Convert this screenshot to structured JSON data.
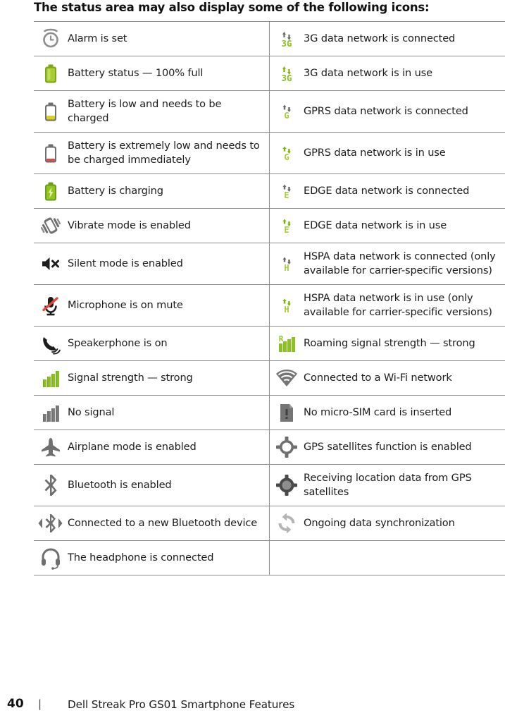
{
  "intro": {
    "text": "The status area may also display some of the following icons:"
  },
  "colors": {
    "green_bright": "#8bc220",
    "green_light": "#a6ce39",
    "green_dark": "#6a9e14",
    "gray_dark": "#555555",
    "gray_mid": "#7d7d7d",
    "gray_light": "#a8a8a8",
    "yellow": "#d8d119",
    "red": "#e8453c",
    "rule": "#8c8c8c",
    "text": "#1c1c1c"
  },
  "table": {
    "rows": [
      {
        "left": {
          "icon": "alarm-clock-icon",
          "label": "Alarm is set"
        },
        "right": {
          "icon": "3g-connected-icon",
          "label": "3G data network is connected"
        }
      },
      {
        "left": {
          "icon": "battery-full-icon",
          "label": "Battery status — 100% full"
        },
        "right": {
          "icon": "3g-in-use-icon",
          "label": "3G data network is in use"
        }
      },
      {
        "left": {
          "icon": "battery-low-icon",
          "label": "Battery is low and needs to be charged"
        },
        "right": {
          "icon": "gprs-connected-icon",
          "label": "GPRS data network is connected"
        }
      },
      {
        "left": {
          "icon": "battery-critical-icon",
          "label": "Battery is extremely low and needs to be charged immediately"
        },
        "right": {
          "icon": "gprs-in-use-icon",
          "label": "GPRS data network is in use"
        }
      },
      {
        "left": {
          "icon": "battery-charging-icon",
          "label": "Battery is charging"
        },
        "right": {
          "icon": "edge-connected-icon",
          "label": "EDGE data network is connected"
        }
      },
      {
        "left": {
          "icon": "vibrate-icon",
          "label": "Vibrate mode is enabled"
        },
        "right": {
          "icon": "edge-in-use-icon",
          "label": "EDGE data network is in use"
        }
      },
      {
        "left": {
          "icon": "silent-mode-icon",
          "label": "Silent mode is enabled"
        },
        "right": {
          "icon": "hspa-connected-icon",
          "label": "HSPA data network is connected (only available for carrier-specific versions)"
        }
      },
      {
        "left": {
          "icon": "microphone-mute-icon",
          "label": "Microphone is on mute"
        },
        "right": {
          "icon": "hspa-in-use-icon",
          "label": "HSPA data network is in use (only available for carrier-specific versions)"
        }
      },
      {
        "left": {
          "icon": "speakerphone-icon",
          "label": "Speakerphone is on"
        },
        "right": {
          "icon": "roaming-signal-icon",
          "label": "Roaming signal strength — strong"
        }
      },
      {
        "left": {
          "icon": "signal-strong-icon",
          "label": "Signal strength — strong"
        },
        "right": {
          "icon": "wifi-icon",
          "label": "Connected to a Wi-Fi network"
        }
      },
      {
        "left": {
          "icon": "no-signal-icon",
          "label": "No signal"
        },
        "right": {
          "icon": "no-sim-card-icon",
          "label": "No micro-SIM card is inserted"
        }
      },
      {
        "left": {
          "icon": "airplane-mode-icon",
          "label": "Airplane mode is enabled"
        },
        "right": {
          "icon": "gps-enabled-icon",
          "label": "GPS satellites function is enabled"
        }
      },
      {
        "left": {
          "icon": "bluetooth-icon",
          "label": "Bluetooth is enabled"
        },
        "right": {
          "icon": "gps-receiving-icon",
          "label": "Receiving location data from GPS satellites"
        }
      },
      {
        "left": {
          "icon": "bluetooth-connected-icon",
          "label": "Connected to a new Bluetooth device"
        },
        "right": {
          "icon": "sync-icon",
          "label": "Ongoing data synchronization"
        }
      },
      {
        "left": {
          "icon": "headphone-icon",
          "label": "The headphone is connected"
        },
        "right": {
          "icon": "",
          "label": ""
        }
      }
    ]
  },
  "footer": {
    "page_number": "40",
    "separator": "|",
    "title": "Dell Streak Pro GS01 Smartphone Features"
  }
}
